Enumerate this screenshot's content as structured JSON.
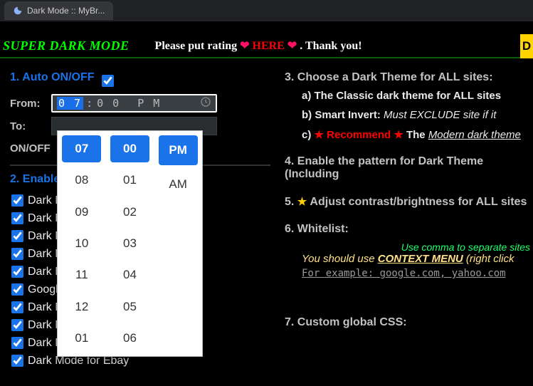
{
  "tab": {
    "title": "Dark Mode :: MyBr..."
  },
  "banner": {
    "title": "SUPER DARK MODE",
    "plea_pre": "Please put rating ",
    "here": "HERE",
    "plea_post": ". Thank you!",
    "donate": "D"
  },
  "left": {
    "auto_h": "1. Auto ON/OFF",
    "from": "From:",
    "to": "To:",
    "time_display": {
      "hh": "0 7",
      "sep": ":",
      "mm": "0 0",
      "ampm": "P M"
    },
    "onoff": "ON/OFF",
    "enable_h": "2. Enable/disable the extension for:",
    "sites": [
      "Dark Mode",
      "Dark Mode",
      "Dark Mode",
      "Dark Mode",
      "Dark Mode",
      "Google Dark",
      "Dark Mode",
      "Dark Mode for Youtube",
      "Dark Mode for Google Inbox",
      "Dark Mode for Ebay"
    ]
  },
  "right": {
    "h3": "3. Choose a Dark Theme for ALL sites:",
    "a": "a) The Classic dark theme for ALL sites",
    "b_pre": "b) Smart Invert: ",
    "b_em": "Must EXCLUDE site if it",
    "c_pre": "c) ",
    "c_rec": "Recommend",
    "c_the": " The ",
    "c_modern": "Modern dark theme",
    "h4": "4. Enable the pattern for Dark Theme (Including",
    "h5_pre": "5. ",
    "h5": "Adjust contrast/brightness for ALL sites",
    "h6": "6. Whitelist:",
    "note": "Use comma to separate sites",
    "note2_pre": "You should use ",
    "note2_cm": "CONTEXT MENU",
    "note2_post": " (right click",
    "example": "For example: google.com, yahoo.com",
    "h7": "7. Custom global CSS:"
  },
  "picker": {
    "hours": [
      "07",
      "08",
      "09",
      "10",
      "11",
      "12",
      "01"
    ],
    "minutes": [
      "00",
      "01",
      "02",
      "03",
      "04",
      "05",
      "06"
    ],
    "ampm": [
      "PM",
      "AM"
    ],
    "sel": {
      "h": "07",
      "m": "00",
      "a": "PM"
    }
  }
}
